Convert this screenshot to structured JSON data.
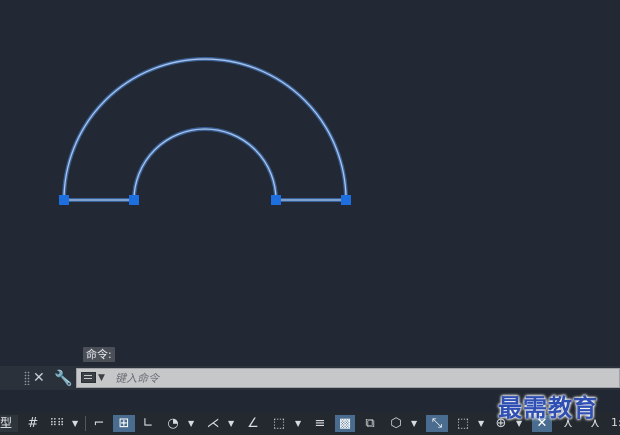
{
  "drawing": {
    "outer_radius": 141,
    "inner_radius": 71,
    "line_color": "#a9c3ee",
    "glow_color": "#4d8fe6",
    "grip_color": "#1d6fe0"
  },
  "command": {
    "prompt_label": "命令:",
    "input_placeholder": "键入命令"
  },
  "status": {
    "model_tab": "模型",
    "zoom": "1:"
  },
  "icons": [
    "grid-icon",
    "snap-grid-icon",
    "infer-constraints-icon",
    "snap-mode-icon",
    "ortho-icon",
    "polar-tracking-icon",
    "isometric-icon",
    "object-snap-tracking-icon",
    "object-snap-icon",
    "lineweight-icon",
    "transparency-icon",
    "selection-cycling-icon",
    "3d-object-snap-icon",
    "dynamic-ucs-icon",
    "selection-filter-icon",
    "gizmo-icon",
    "annotation-visibility-icon",
    "autoscale-icon",
    "annotation-scale-icon"
  ],
  "watermark": "最需教育"
}
